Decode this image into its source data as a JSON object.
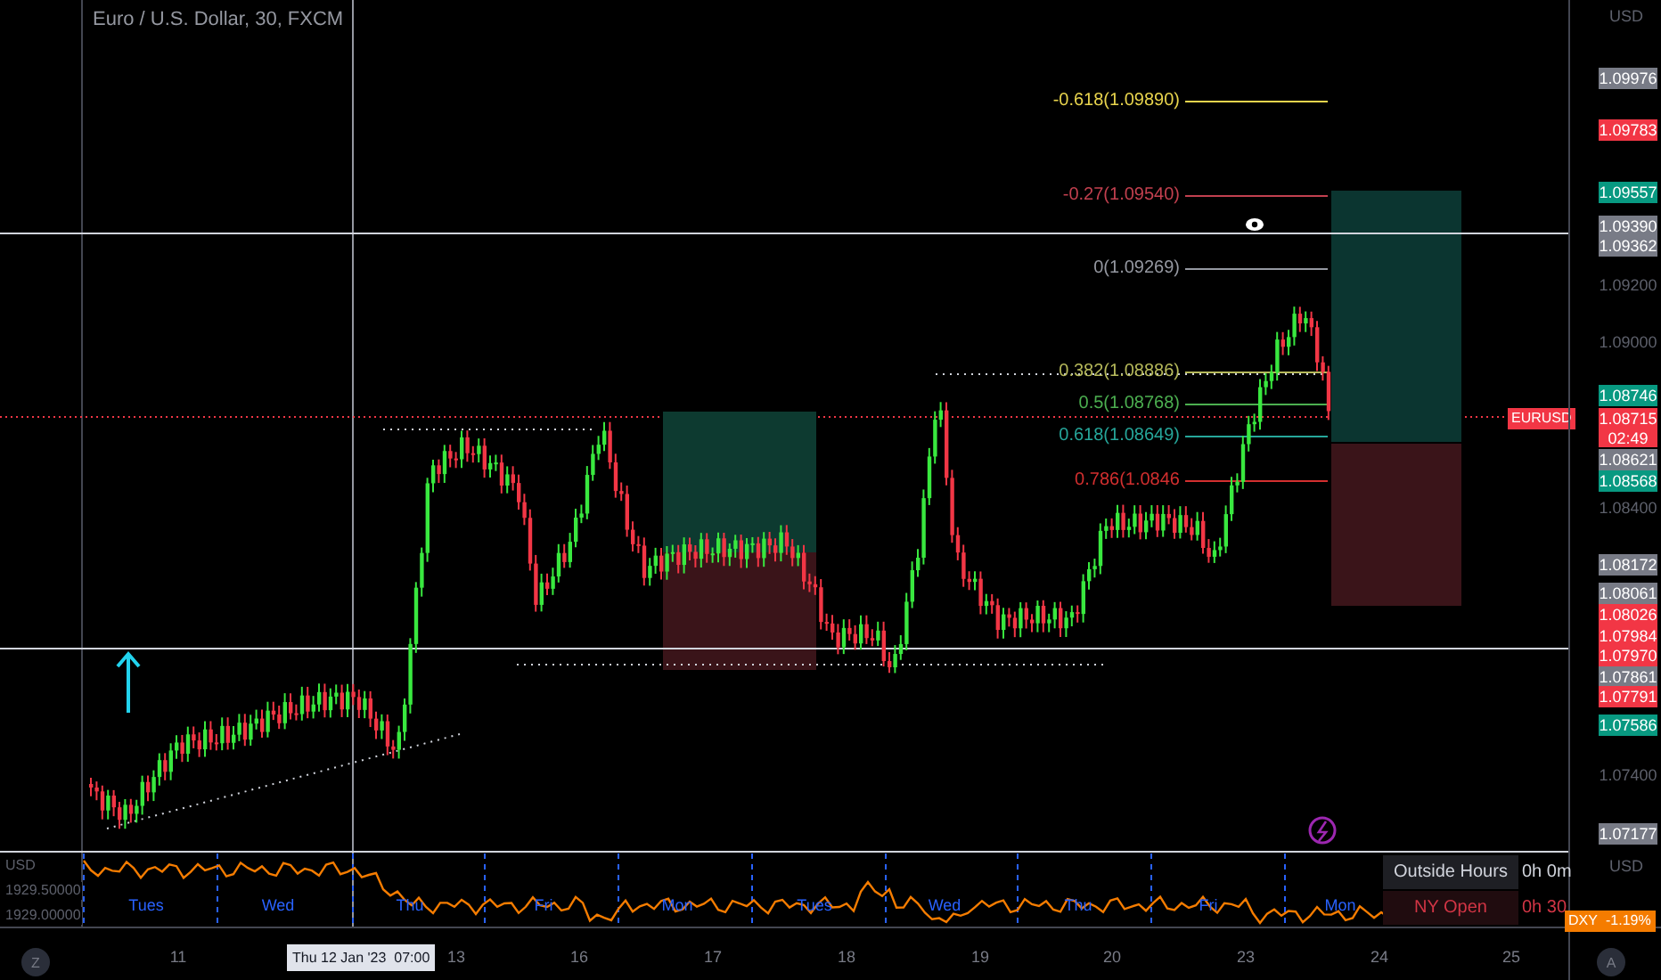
{
  "chart": {
    "title": "Euro / U.S. Dollar, 30, FXCM",
    "symbol_tag": "EURUSD",
    "fib_levels": [
      {
        "label": "-0.618(1.09890)",
        "color": "#e8d44d"
      },
      {
        "label": "-0.27(1.09540)",
        "color": "#c2404f"
      },
      {
        "label": "0(1.09269)",
        "color": "#9598a1"
      },
      {
        "label": "0.382(1.08886)",
        "color": "#b5b85a"
      },
      {
        "label": "0.5(1.08768)",
        "color": "#4caf50"
      },
      {
        "label": "0.618(1.08649)",
        "color": "#26a69a"
      },
      {
        "label": "0.786(1.0846",
        "color": "#d32f2f"
      }
    ]
  },
  "price_axis": {
    "unit": "USD",
    "labels": [
      {
        "kind": "tag",
        "text": "1.09976",
        "color": "#787b86"
      },
      {
        "kind": "tag",
        "text": "1.09783",
        "color": "#f23645"
      },
      {
        "kind": "tag",
        "text": "1.09557",
        "color": "#089981"
      },
      {
        "kind": "tag",
        "text": "1.09390",
        "color": "#787b86"
      },
      {
        "kind": "tag",
        "text": "1.09362",
        "color": "#787b86"
      },
      {
        "kind": "tick",
        "text": "1.09200"
      },
      {
        "kind": "tick",
        "text": "1.09000"
      },
      {
        "kind": "tag",
        "text": "1.08746",
        "color": "#089981"
      },
      {
        "kind": "tag",
        "text": "1.08715",
        "color": "#f23645",
        "countdown": "02:49"
      },
      {
        "kind": "tag",
        "text": "1.08621",
        "color": "#787b86"
      },
      {
        "kind": "tag",
        "text": "1.08568",
        "color": "#089981"
      },
      {
        "kind": "tick",
        "text": "1.08400"
      },
      {
        "kind": "tag",
        "text": "1.08172",
        "color": "#787b86"
      },
      {
        "kind": "tag",
        "text": "1.08061",
        "color": "#787b86"
      },
      {
        "kind": "tag",
        "text": "1.08026",
        "color": "#f23645"
      },
      {
        "kind": "tag",
        "text": "1.07984",
        "color": "#f23645"
      },
      {
        "kind": "tag",
        "text": "1.07970",
        "color": "#f23645"
      },
      {
        "kind": "tag",
        "text": "1.07861",
        "color": "#787b86"
      },
      {
        "kind": "tag",
        "text": "1.07791",
        "color": "#f23645"
      },
      {
        "kind": "tag",
        "text": "1.07586",
        "color": "#089981"
      },
      {
        "kind": "tick",
        "text": "1.07400"
      },
      {
        "kind": "tag",
        "text": "1.07177",
        "color": "#787b86"
      }
    ]
  },
  "indicator": {
    "unit": "USD",
    "scale": [
      "1929.50000",
      "1929.00000"
    ],
    "day_labels": [
      "Tues",
      "Wed",
      "Thu",
      "Fri",
      "Mon",
      "Tues",
      "Wed",
      "Thu",
      "Fri",
      "Mon"
    ],
    "sessions": [
      {
        "label": "Outside Hours",
        "time": "0h 0m",
        "selected": true
      },
      {
        "label": "NY Open",
        "time": "0h 30",
        "selected": false
      }
    ],
    "axis_unit": "USD",
    "symbol_tag": "DXY",
    "change": "-1.19%"
  },
  "time_axis": {
    "ticks": [
      "11",
      "13",
      "16",
      "17",
      "18",
      "19",
      "20",
      "23",
      "24",
      "25"
    ],
    "crosshair_label": "Thu 12 Jan '23  07:00",
    "left_button": "Z",
    "right_button": "A"
  }
}
